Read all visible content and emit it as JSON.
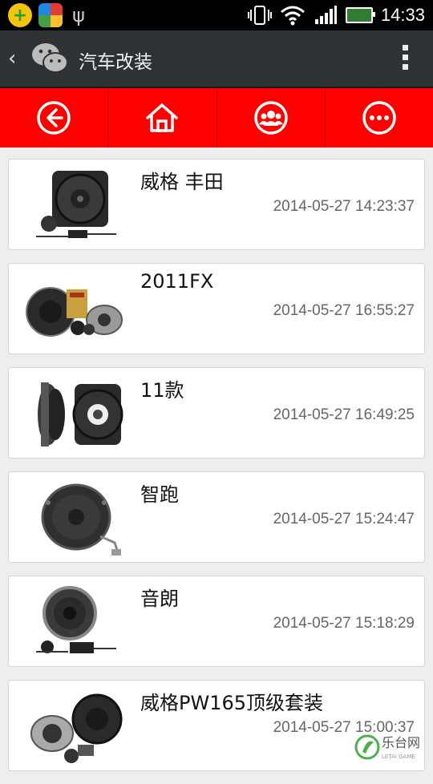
{
  "status_bar": {
    "time": "14:33",
    "icons": [
      "app-notification-icon",
      "app-store-icon",
      "usb-icon",
      "vibrate-icon",
      "wifi-icon",
      "signal-icon",
      "battery-icon"
    ]
  },
  "title_bar": {
    "title": "汽车改装",
    "icons": [
      "back-icon",
      "wechat-icon",
      "more-icon"
    ]
  },
  "nav": {
    "items": [
      {
        "name": "back",
        "icon": "circle-arrow-left-icon"
      },
      {
        "name": "home",
        "icon": "home-icon"
      },
      {
        "name": "contacts",
        "icon": "people-icon"
      },
      {
        "name": "more",
        "icon": "ellipsis-circle-icon"
      }
    ],
    "color": "#ff0000"
  },
  "list": {
    "items": [
      {
        "title": "威格 丰田",
        "date": "2014-05-27 14:23:37"
      },
      {
        "title": "2011FX",
        "date": "2014-05-27 16:55:27"
      },
      {
        "title": "11款",
        "date": "2014-05-27 16:49:25"
      },
      {
        "title": "智跑",
        "date": "2014-05-27 15:24:47"
      },
      {
        "title": "音朗",
        "date": "2014-05-27 15:18:29"
      },
      {
        "title": "威格PW165顶级套装",
        "date": "2014-05-27 15:00:37"
      }
    ]
  },
  "watermark": {
    "text": "乐台网",
    "sub": "LETAI GAME"
  }
}
